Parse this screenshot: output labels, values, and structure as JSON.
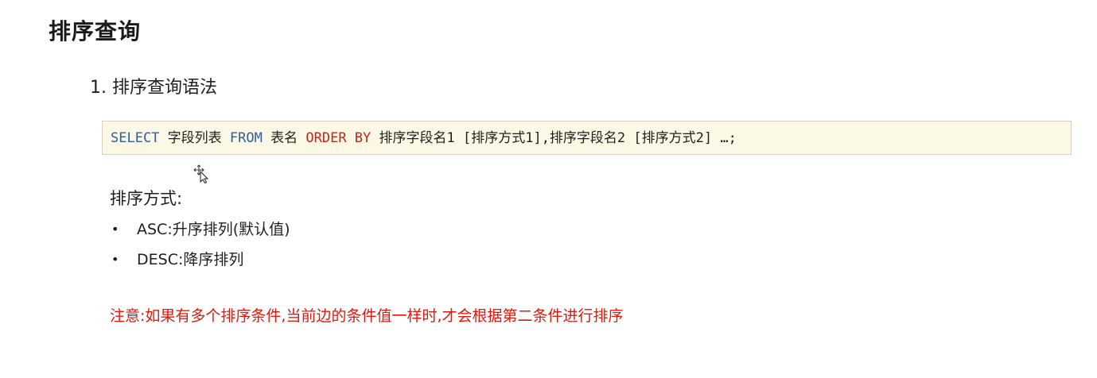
{
  "page": {
    "title": "排序查询",
    "section_heading": "1. 排序查询语法",
    "code": {
      "select": "SELECT",
      "field_list": "字段列表",
      "from": "FROM",
      "table_name": "表名",
      "order_by": "ORDER BY",
      "rest": "排序字段名1 [排序方式1],排序字段名2 [排序方式2] …;"
    },
    "sort_methods_label": "排序方式:",
    "bullets": [
      {
        "text": "ASC:升序排列(默认值)"
      },
      {
        "text": "DESC:降序排列"
      }
    ],
    "note": "注意:如果有多个排序条件,当前边的条件值一样时,才会根据第二条件进行排序"
  },
  "colors": {
    "keyword_blue": "#2d5fa8",
    "keyword_red": "#c0281e",
    "note_red": "#e0190e",
    "code_background": "#fbf8e5"
  },
  "icons": {
    "cursor": "mouse-move-cursor-icon"
  }
}
